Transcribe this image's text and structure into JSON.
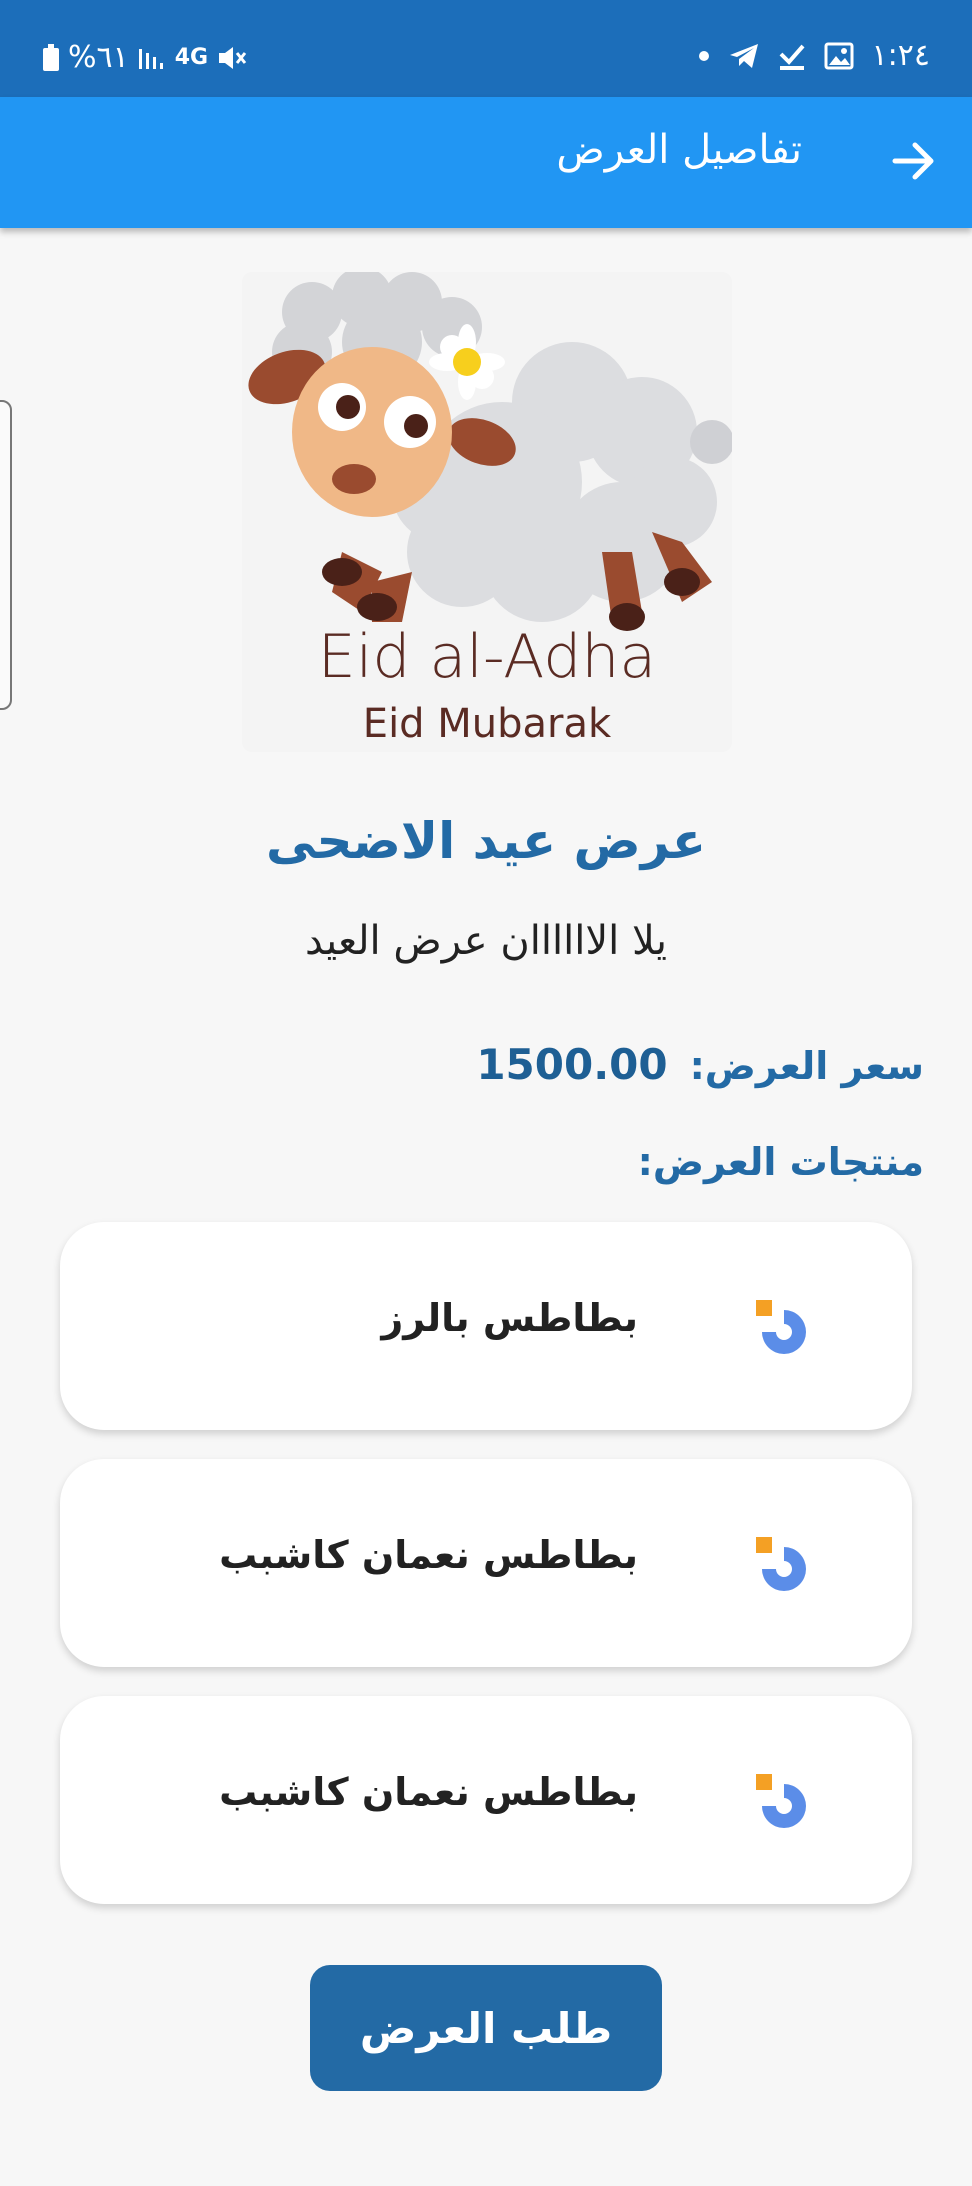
{
  "status_bar": {
    "battery_text": "%٦١",
    "network": "4G",
    "time": "١:٢٤"
  },
  "app_bar": {
    "title": "تفاصيل العرض",
    "back_icon": "arrow-right-icon"
  },
  "hero": {
    "line1": "Eid al-Adha",
    "line2": "Eid Mubarak"
  },
  "offer": {
    "title": "عرض عيد الاضحى",
    "description": "يلا الاااااان عرض العيد",
    "price_label": "سعر العرض:",
    "price_value": "1500.00",
    "products_label": "منتجات العرض:"
  },
  "products": [
    {
      "name": "بطاطس بالرز",
      "icon": "loading-logo-icon"
    },
    {
      "name": "بطاطس نعمان كاشبب",
      "icon": "loading-logo-icon"
    },
    {
      "name": "بطاطس نعمان كاشبب",
      "icon": "loading-logo-icon"
    }
  ],
  "order_button": "طلب العرض",
  "colors": {
    "status_bar": "#1c6eba",
    "app_bar": "#2196f3",
    "accent": "#236aa5"
  }
}
